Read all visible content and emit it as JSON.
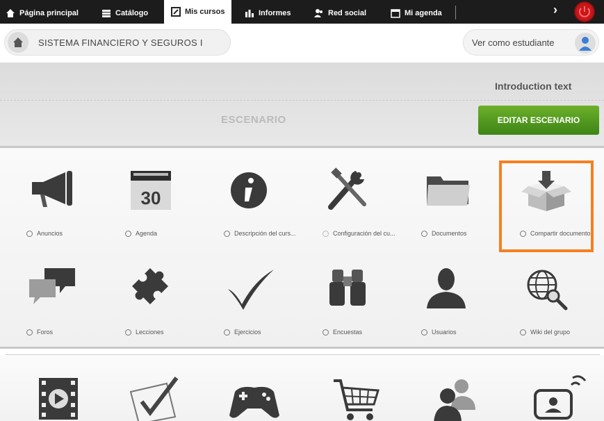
{
  "nav": {
    "tabs": [
      {
        "label": "Página principal",
        "icon": "home-icon"
      },
      {
        "label": "Catálogo",
        "icon": "catalog-icon"
      },
      {
        "label": "Mis cursos",
        "icon": "courses-icon",
        "active": true
      },
      {
        "label": "Informes",
        "icon": "reports-icon"
      },
      {
        "label": "Red social",
        "icon": "social-icon"
      },
      {
        "label": "Mi agenda",
        "icon": "agenda-icon"
      }
    ],
    "next": "›"
  },
  "course": {
    "title": "SISTEMA FINANCIERO Y SEGUROS I",
    "student_view": "Ver como estudiante"
  },
  "scenario": {
    "intro": "Introduction text",
    "title": "ESCENARIO",
    "edit_button": "EDITAR ESCENARIO"
  },
  "tools": [
    {
      "label": "Anuncios",
      "icon": "megaphone-icon"
    },
    {
      "label": "Agenda",
      "icon": "calendar-icon",
      "day": "30"
    },
    {
      "label": "Descripción del curs...",
      "icon": "info-icon"
    },
    {
      "label": "Configuración del cu...",
      "icon": "settings-tools-icon"
    },
    {
      "label": "Documentos",
      "icon": "folder-icon"
    },
    {
      "label": "Compartir documentos",
      "icon": "share-box-icon",
      "highlighted": true
    },
    {
      "label": "Foros",
      "icon": "forum-icon"
    },
    {
      "label": "Lecciones",
      "icon": "puzzle-icon"
    },
    {
      "label": "Ejercicios",
      "icon": "checkmark-icon"
    },
    {
      "label": "Encuestas",
      "icon": "binoculars-icon"
    },
    {
      "label": "Usuarios",
      "icon": "user-icon"
    },
    {
      "label": "Wiki del grupo",
      "icon": "globe-search-icon"
    }
  ],
  "tools_row2": [
    {
      "icon": "video-icon"
    },
    {
      "icon": "assessment-check-icon"
    },
    {
      "icon": "gamepad-icon"
    },
    {
      "icon": "cart-icon"
    },
    {
      "icon": "groups-icon"
    },
    {
      "icon": "videoconference-icon"
    }
  ],
  "colors": {
    "nav_bg": "#1c1c1c",
    "edit_button": "#4f9a1e",
    "highlight": "#f58020",
    "power": "#c8171a"
  }
}
